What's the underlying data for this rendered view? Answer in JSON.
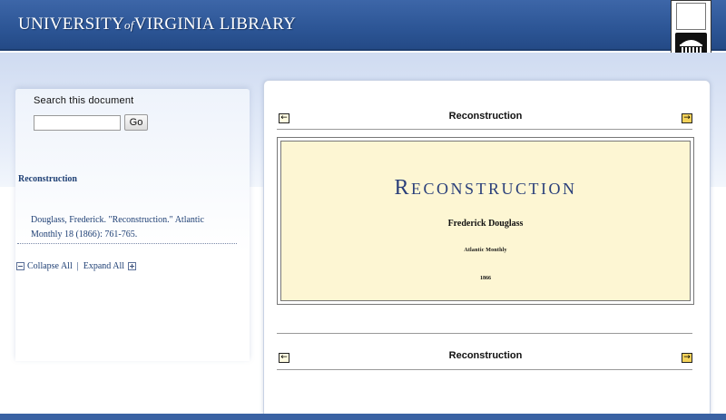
{
  "header": {
    "logo": {
      "part1": "University",
      "of": "of",
      "part2": "Virginia",
      "part3": "Library"
    },
    "rotunda_icon": "rotunda-icon",
    "colors": {
      "header_bg": "#2c5595",
      "accent": "#1e3f74",
      "page_bg": "#fdf6d3",
      "arrow_next": "#f3d25a"
    }
  },
  "sidebar": {
    "search_label": "Search this document",
    "search_value": "",
    "go_label": "Go",
    "toc_title": "Reconstruction",
    "citation": "Douglass, Frederick. \"Reconstruction.\" Atlantic Monthly 18 (1866): 761-765.",
    "collapse_label": "Collapse All",
    "separator": "|",
    "expand_label": "Expand All"
  },
  "document": {
    "nav_top": {
      "prev_icon": "←",
      "title": "Reconstruction",
      "next_icon": "→"
    },
    "nav_bottom": {
      "prev_icon": "←",
      "title": "Reconstruction",
      "next_icon": "→"
    },
    "title_page": {
      "heading_first": "R",
      "heading_rest": "econstruction",
      "author": "Frederick Douglass",
      "journal": "Atlantic Monthly",
      "year": "1866"
    }
  }
}
